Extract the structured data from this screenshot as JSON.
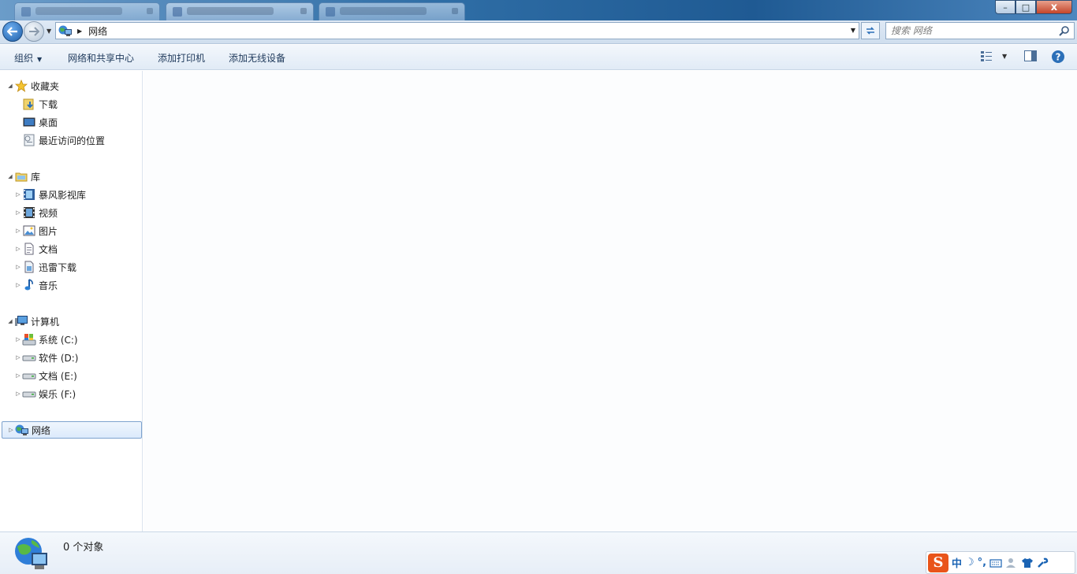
{
  "window": {
    "minimize_glyph": "–",
    "maximize_glyph": "□",
    "close_glyph": "x"
  },
  "address": {
    "location": "网络",
    "search_placeholder": "搜索 网络"
  },
  "commands": {
    "organize": "组织",
    "network_center": "网络和共享中心",
    "add_printer": "添加打印机",
    "add_wireless": "添加无线设备"
  },
  "nav": {
    "favorites": {
      "label": "收藏夹",
      "items": [
        "下载",
        "桌面",
        "最近访问的位置"
      ]
    },
    "libraries": {
      "label": "库",
      "items": [
        "暴风影视库",
        "视频",
        "图片",
        "文档",
        "迅雷下载",
        "音乐"
      ]
    },
    "computer": {
      "label": "计算机",
      "items": [
        "系统 (C:)",
        "软件 (D:)",
        "文档 (E:)",
        "娱乐 (F:)"
      ]
    },
    "network": {
      "label": "网络"
    }
  },
  "status": {
    "object_count": "0 个对象"
  },
  "ime": {
    "logo": "S",
    "lang": "中",
    "moon": "☽",
    "punct": "°,"
  },
  "colors": {
    "accent": "#2b6fb8",
    "selection_border": "#7da2ce",
    "ime_brand": "#e9541a"
  }
}
